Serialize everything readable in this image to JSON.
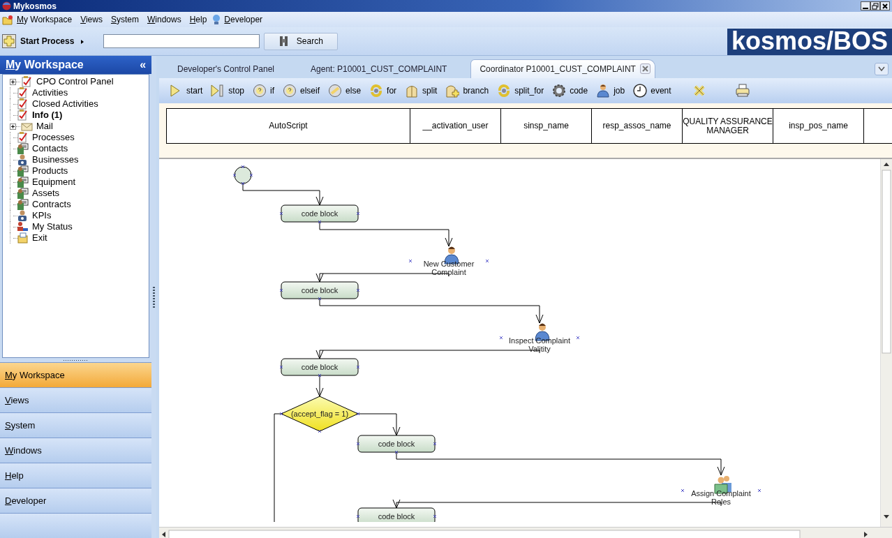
{
  "window": {
    "title": "Mykosmos"
  },
  "menu": [
    {
      "label": "My Workspace",
      "kind": "workspace"
    },
    {
      "label": "Views",
      "kind": "plain"
    },
    {
      "label": "System",
      "kind": "plain"
    },
    {
      "label": "Windows",
      "kind": "plain"
    },
    {
      "label": "Help",
      "kind": "plain"
    },
    {
      "label": "Developer",
      "kind": "developer"
    }
  ],
  "toolbar": {
    "start_process": "Start Process",
    "search": {
      "label": "Search"
    },
    "logo": "kosmos/BOS"
  },
  "sidebar": {
    "title": "My Workspace",
    "collapse": "«",
    "tree": [
      {
        "label": "CPO Control Panel",
        "kind": "checklist",
        "expandable": true,
        "bold": false
      },
      {
        "label": "Activities",
        "kind": "checklist",
        "expandable": false,
        "bold": false
      },
      {
        "label": "Closed Activities",
        "kind": "checklist",
        "expandable": false,
        "bold": false
      },
      {
        "label": "Info (1)",
        "kind": "checklist",
        "expandable": false,
        "bold": true
      },
      {
        "label": "Mail",
        "kind": "mail",
        "expandable": true,
        "bold": false
      },
      {
        "label": "Processes",
        "kind": "checklist",
        "expandable": false,
        "bold": false
      },
      {
        "label": "Contacts",
        "kind": "card",
        "expandable": false,
        "bold": false
      },
      {
        "label": "Businesses",
        "kind": "badge",
        "expandable": false,
        "bold": false
      },
      {
        "label": "Products",
        "kind": "card",
        "expandable": false,
        "bold": false
      },
      {
        "label": "Equipment",
        "kind": "card",
        "expandable": false,
        "bold": false
      },
      {
        "label": "Assets",
        "kind": "card",
        "expandable": false,
        "bold": false
      },
      {
        "label": "Contracts",
        "kind": "card",
        "expandable": false,
        "bold": false
      },
      {
        "label": "KPIs",
        "kind": "badge",
        "expandable": false,
        "bold": false
      },
      {
        "label": "My Status",
        "kind": "status",
        "expandable": false,
        "bold": false
      },
      {
        "label": "Exit",
        "kind": "exit",
        "expandable": false,
        "bold": false
      }
    ],
    "nav": [
      {
        "label": "My Workspace",
        "selected": true
      },
      {
        "label": "Views",
        "selected": false
      },
      {
        "label": "System",
        "selected": false
      },
      {
        "label": "Windows",
        "selected": false
      },
      {
        "label": "Help",
        "selected": false
      },
      {
        "label": "Developer",
        "selected": false
      },
      {
        "selected": false
      }
    ]
  },
  "tabs": [
    {
      "label": "Developer's Control Panel",
      "selected": false,
      "closable": false
    },
    {
      "label": "Agent: P10001_CUST_COMPLAINT",
      "selected": false,
      "closable": false
    },
    {
      "label": "Coordinator P10001_CUST_COMPLAINT",
      "selected": true,
      "closable": true
    }
  ],
  "palette": [
    {
      "label": "start",
      "kind": "start"
    },
    {
      "label": "stop",
      "kind": "stop"
    },
    {
      "label": "if",
      "kind": "if"
    },
    {
      "label": "elseif",
      "kind": "if"
    },
    {
      "label": "else",
      "kind": "else"
    },
    {
      "label": "for",
      "kind": "loop"
    },
    {
      "label": "split",
      "kind": "split"
    },
    {
      "label": "branch",
      "kind": "branch"
    },
    {
      "label": "split_for",
      "kind": "loop"
    },
    {
      "label": "code",
      "kind": "gear"
    },
    {
      "label": "job",
      "kind": "person"
    },
    {
      "label": "event",
      "kind": "clock"
    },
    {
      "kind": "delete"
    },
    {
      "kind": "print"
    }
  ],
  "table": {
    "columns": [
      "AutoScript",
      "__activation_user",
      "sinsp_name",
      "resp_assos_name",
      "QUALITY ASSURANCE MANAGER",
      "insp_pos_name",
      ""
    ]
  },
  "diagram": {
    "nodes": [
      {
        "kind": "start"
      },
      {
        "kind": "code",
        "label_lines": [
          "code block"
        ]
      },
      {
        "kind": "job",
        "label_lines": [
          "New Customer",
          "Complaint"
        ]
      },
      {
        "kind": "code",
        "label_lines": [
          "code block"
        ]
      },
      {
        "kind": "job",
        "label_lines": [
          "Inspect Complaint",
          "Valitity"
        ]
      },
      {
        "kind": "code",
        "label_lines": [
          "code block"
        ]
      },
      {
        "kind": "condition",
        "label_lines": [
          "(accept_flag = 1)"
        ]
      },
      {
        "kind": "code",
        "label_lines": [
          "code block"
        ]
      },
      {
        "kind": "group",
        "label_lines": [
          "Assign Complaint",
          "Roles"
        ]
      },
      {
        "kind": "code",
        "label_lines": [
          "code block"
        ]
      }
    ]
  }
}
